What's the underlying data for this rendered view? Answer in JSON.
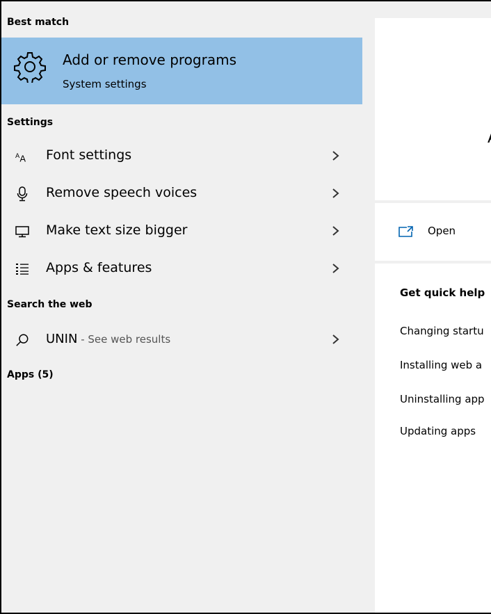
{
  "best_match": {
    "header": "Best match",
    "title": "Add or remove programs",
    "subtitle": "System settings",
    "icon": "gear-icon"
  },
  "settings": {
    "header": "Settings",
    "items": [
      {
        "label": "Font settings",
        "icon": "font-icon"
      },
      {
        "label": "Remove speech voices",
        "icon": "microphone-icon"
      },
      {
        "label": "Make text size bigger",
        "icon": "monitor-icon"
      },
      {
        "label": "Apps & features",
        "icon": "list-icon"
      }
    ]
  },
  "web": {
    "header": "Search the web",
    "query": "UNIN",
    "hint": " - See web results",
    "icon": "search-icon"
  },
  "apps": {
    "header": "Apps (5)"
  },
  "preview": {
    "title_initial": "A",
    "open_label": "Open",
    "help_title": "Get quick help",
    "help_links": [
      "Changing startu",
      "Installing web a",
      "Uninstalling app",
      "Updating apps"
    ]
  },
  "colors": {
    "selected_bg": "#92c0e6",
    "pane_bg": "#f0f0f0",
    "accent": "#0063b1"
  }
}
